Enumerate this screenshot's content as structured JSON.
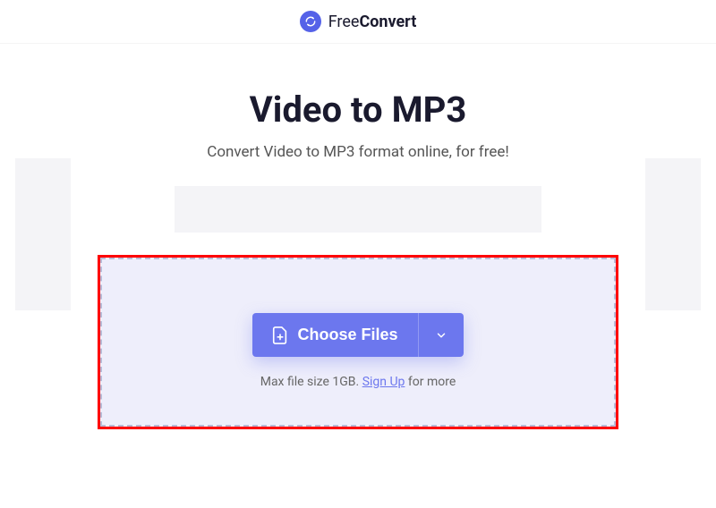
{
  "header": {
    "brand_free": "Free",
    "brand_convert": "Convert"
  },
  "main": {
    "title": "Video to MP3",
    "subtitle": "Convert Video to MP3 format online, for free!"
  },
  "upload": {
    "choose_label": "Choose Files",
    "hint_prefix": "Max file size 1GB. ",
    "signup_label": "Sign Up",
    "hint_suffix": " for more"
  }
}
